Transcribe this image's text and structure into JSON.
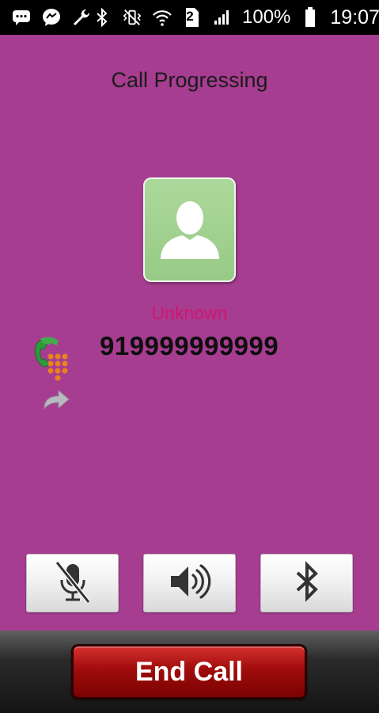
{
  "status_bar": {
    "signal_slot": "2",
    "battery": "100%",
    "time": "19:07",
    "icons": [
      "chat-icon",
      "messenger-icon",
      "wrench-icon",
      "bluetooth-icon",
      "vibrate-icon",
      "wifi-icon",
      "sim-icon",
      "signal-icon",
      "battery-icon"
    ]
  },
  "call": {
    "title": "Call Progressing",
    "contact_name": "Unknown",
    "number": "919999999999"
  },
  "controls": {
    "mute_icon": "mic-off-icon",
    "speaker_icon": "speaker-icon",
    "bluetooth_icon": "bluetooth-icon"
  },
  "end_call_label": "End Call",
  "colors": {
    "background": "#a63d91",
    "contact_name": "#d0166e",
    "end_call": "#a00c0c",
    "avatar": "#a2d290"
  }
}
